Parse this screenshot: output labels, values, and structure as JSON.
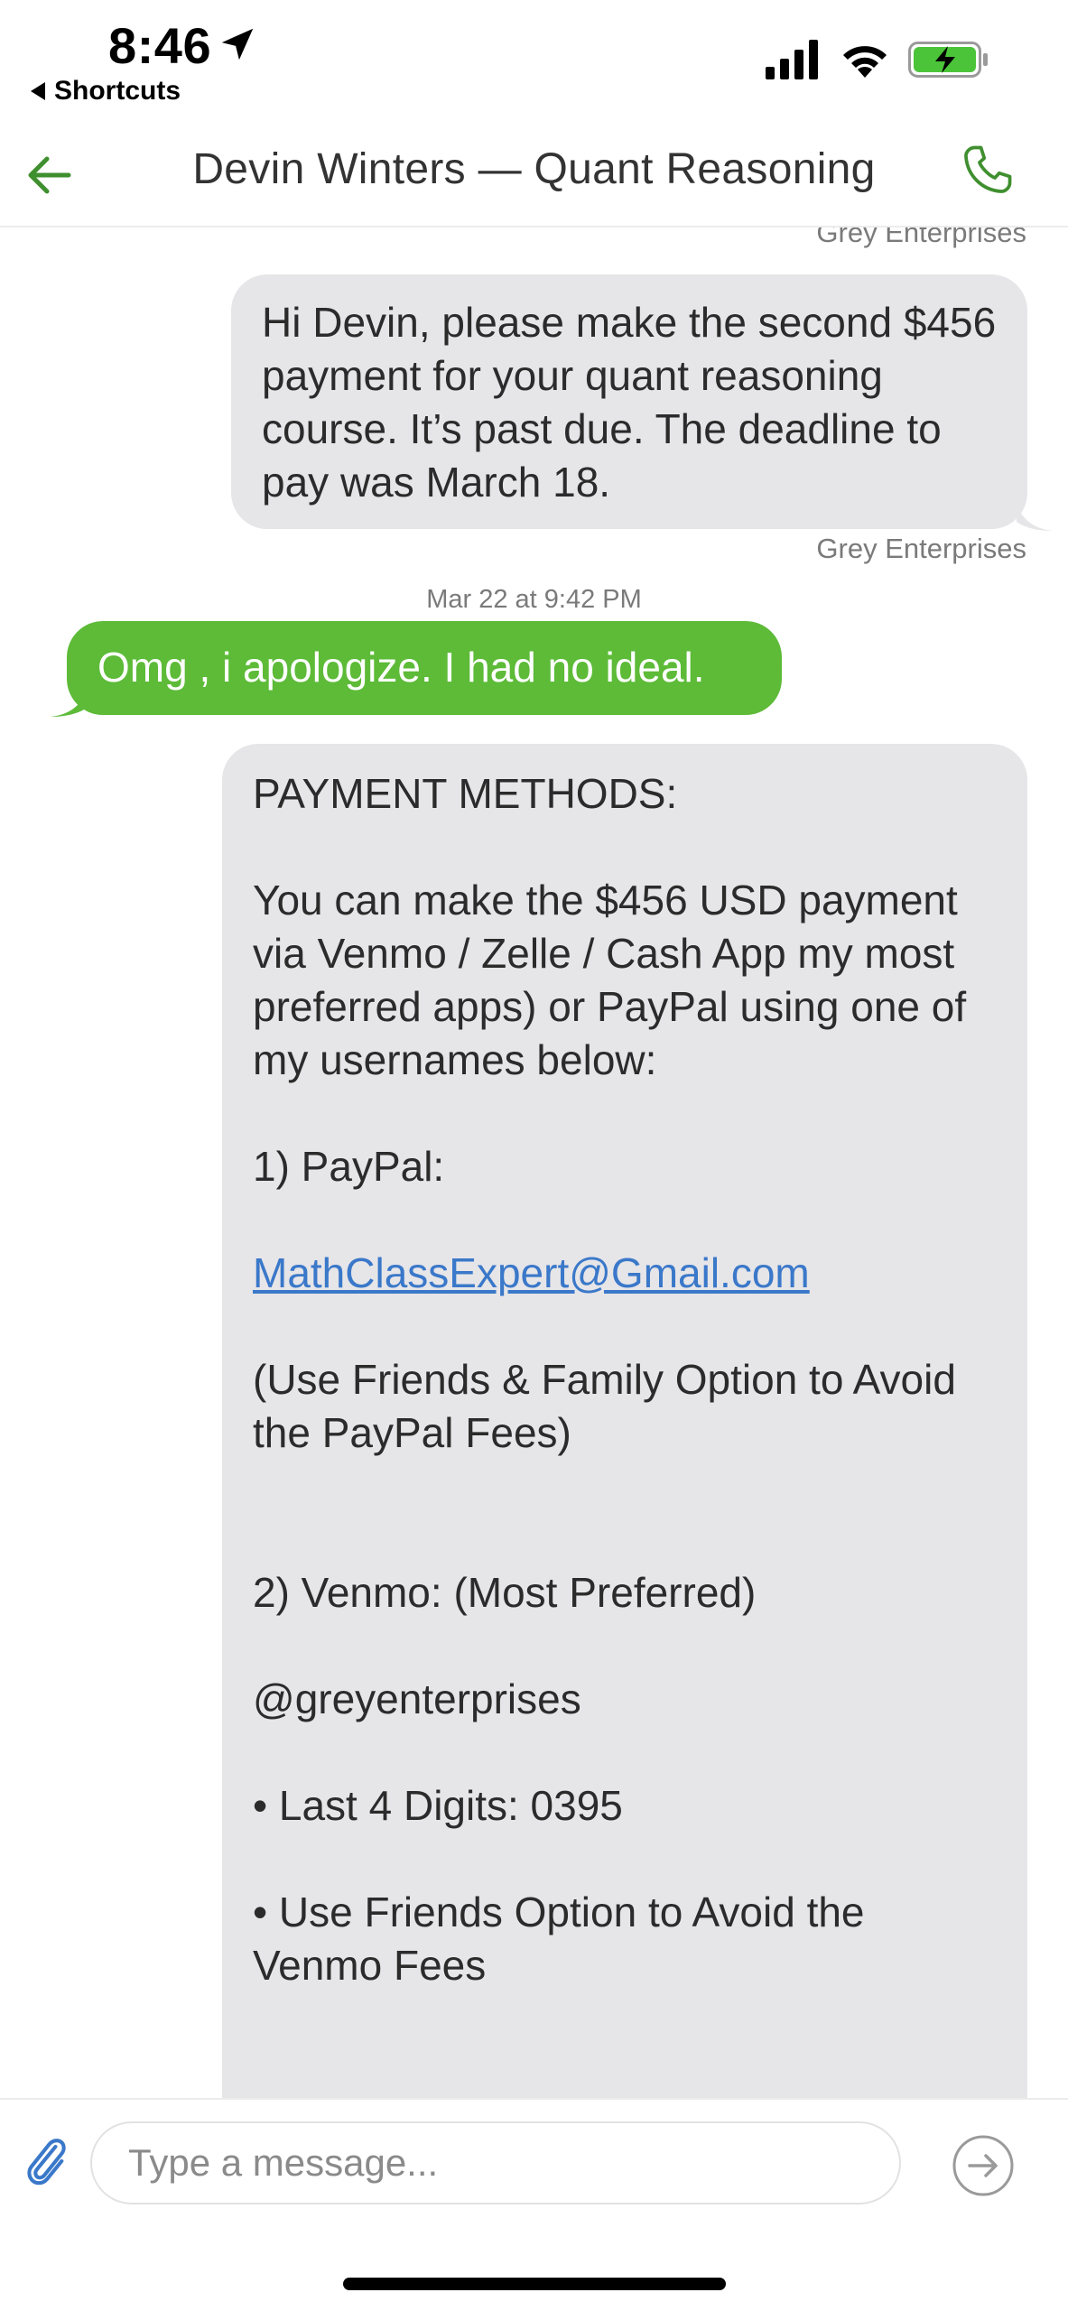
{
  "status_bar": {
    "time": "8:46",
    "back_app": "Shortcuts",
    "location_icon": "location-arrow-icon",
    "signal_icon": "cellular-signal-icon",
    "wifi_icon": "wifi-icon",
    "battery_icon": "battery-charging-icon",
    "battery_color": "#4cc43a"
  },
  "header": {
    "title": "Devin Winters — Quant Reasoning",
    "back_icon": "back-arrow-icon",
    "call_icon": "phone-icon",
    "accent_color": "#3f8f2f"
  },
  "messages": {
    "top_cut_sender": "Grey Enterprises",
    "msg1": {
      "text": "Hi Devin, please make the second $456 payment for your quant reasoning course. It’s past due. The deadline to pay was March 18.",
      "sender": "Grey Enterprises"
    },
    "timestamp2": "Mar 22 at 9:42 PM",
    "msg2": {
      "text": "Omg , i apologize. I had no ideal."
    },
    "msg3": {
      "heading": "PAYMENT METHODS:",
      "intro": "You can make the $456 USD payment via Venmo / Zelle / Cash App my most preferred apps) or PayPal using one of my usernames below:",
      "paypal_label": "1) PayPal:",
      "paypal_email": "MathClassExpert@Gmail.com",
      "paypal_note": "(Use Friends & Family Option to Avoid the PayPal Fees)",
      "venmo_label": "2) Venmo: (Most Preferred)",
      "venmo_handle": "@greyenterprises",
      "venmo_digits": "• Last 4 Digits: 0395",
      "venmo_note": "• Use Friends Option to Avoid the Venmo Fees"
    }
  },
  "composer": {
    "placeholder": "Type a message...",
    "attach_icon": "paperclip-icon",
    "send_icon": "send-arrow-icon"
  },
  "colors": {
    "incoming_bubble": "#e6e5e8",
    "outgoing_bubble": "#5dbb38",
    "link": "#3a78c9"
  }
}
